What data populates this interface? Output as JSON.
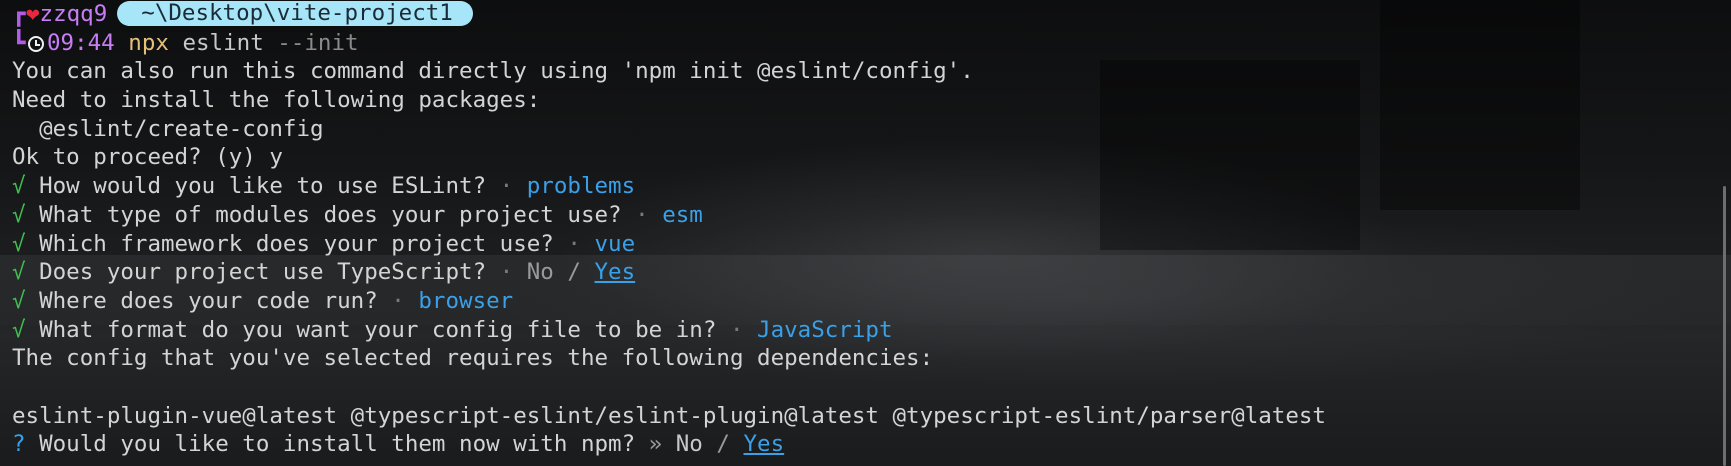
{
  "prompt": {
    "user": "zzqq9",
    "path": "~\\Desktop\\vite-project1",
    "time": "09:44",
    "command_bin": "npx",
    "command_arg": "eslint",
    "command_flag": "--init",
    "heart_color": "#e8293d",
    "pill_color": "#a7e6f8"
  },
  "output": {
    "line1": "You can also run this command directly using 'npm init @eslint/config'.",
    "line2": "Need to install the following packages:",
    "line3": "  @eslint/create-config",
    "line4": "Ok to proceed? (y) y"
  },
  "questions": [
    {
      "mark": "√",
      "text": "How would you like to use ESLint?",
      "sep": "·",
      "answer": "problems"
    },
    {
      "mark": "√",
      "text": "What type of modules does your project use?",
      "sep": "·",
      "answer": "esm"
    },
    {
      "mark": "√",
      "text": "Which framework does your project use?",
      "sep": "·",
      "answer": "vue"
    },
    {
      "mark": "√",
      "text": "Does your project use TypeScript?",
      "sep": "·",
      "option_a": "No",
      "slash": "/",
      "option_b": "Yes"
    },
    {
      "mark": "√",
      "text": "Where does your code run?",
      "sep": "·",
      "answer": "browser"
    },
    {
      "mark": "√",
      "text": "What format do you want your config file to be in?",
      "sep": "·",
      "answer": "JavaScript"
    }
  ],
  "deps": {
    "intro": "The config that you've selected requires the following dependencies:",
    "list": "eslint-plugin-vue@latest @typescript-eslint/eslint-plugin@latest @typescript-eslint/parser@latest"
  },
  "install_prompt": {
    "mark": "?",
    "text": "Would you like to install them now with npm?",
    "sep": "»",
    "option_a": "No",
    "slash": "/",
    "option_b": "Yes"
  },
  "icons": {
    "heart": "heart-icon",
    "clock": "clock-icon",
    "prompt_top": "┏",
    "prompt_bottom": "┗"
  },
  "colors": {
    "check": "#3fbf4f",
    "answer": "#3aa0e8",
    "user": "#c77df5"
  }
}
